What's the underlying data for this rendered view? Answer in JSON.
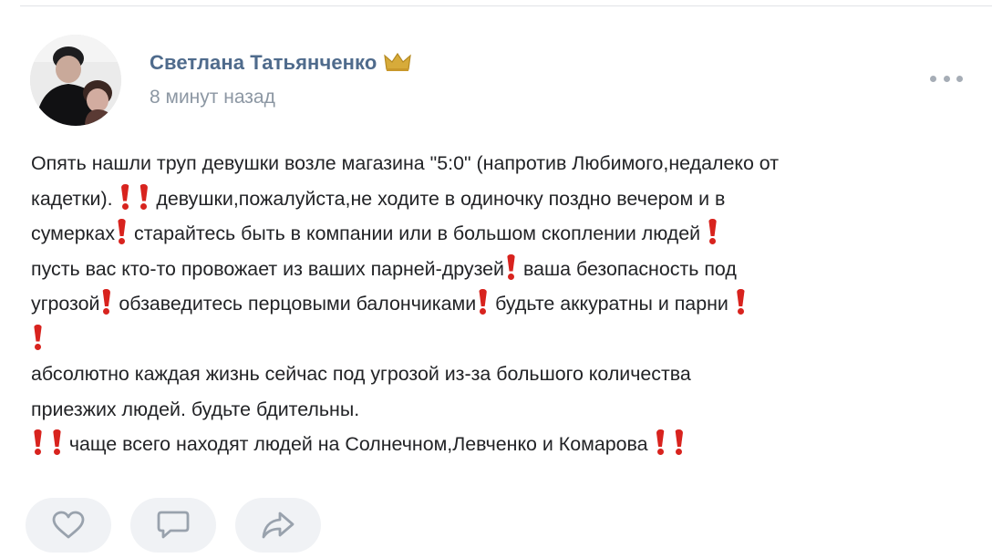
{
  "post": {
    "author_name": "Светлана Татьянченко",
    "author_badge_icon": "crown-icon",
    "time": "8 минут назад",
    "menu_icon": "more-dots-icon",
    "text_lines": [
      [
        {
          "t": "Опять нашли труп девушки возле магазина \"5:0\" (напротив Любимого,недалеко от"
        }
      ],
      [
        {
          "t": "кадетки). "
        },
        {
          "icon": "exclamation"
        },
        {
          "t": " "
        },
        {
          "icon": "exclamation"
        },
        {
          "t": " девушки,пожалуйста,не ходите в одиночку поздно вечером и в"
        }
      ],
      [
        {
          "t": "сумерках"
        },
        {
          "icon": "exclamation"
        },
        {
          "t": " старайтесь быть в компании или в большом скоплении людей "
        },
        {
          "icon": "exclamation"
        }
      ],
      [
        {
          "t": "пусть вас кто-то провожает из ваших парней-друзей"
        },
        {
          "icon": "exclamation"
        },
        {
          "t": " ваша безопасность под"
        }
      ],
      [
        {
          "t": "угрозой"
        },
        {
          "icon": "exclamation"
        },
        {
          "t": " обзаведитесь перцовыми балончиками"
        },
        {
          "icon": "exclamation"
        },
        {
          "t": " будьте аккуратны и парни "
        },
        {
          "icon": "exclamation"
        }
      ],
      [
        {
          "icon": "exclamation"
        }
      ],
      [
        {
          "t": "абсолютно каждая жизнь сейчас под угрозой из-за большого количества"
        }
      ],
      [
        {
          "t": "приезжих людей. будьте бдительны."
        }
      ],
      [
        {
          "icon": "exclamation"
        },
        {
          "t": " "
        },
        {
          "icon": "exclamation"
        },
        {
          "t": " чаще всего находят людей на Солнечном,Левченко и Комарова "
        },
        {
          "icon": "exclamation"
        },
        {
          "t": " "
        },
        {
          "icon": "exclamation"
        }
      ]
    ],
    "actions": [
      {
        "name": "like-button",
        "icon": "heart-icon"
      },
      {
        "name": "comment-button",
        "icon": "comment-icon"
      },
      {
        "name": "share-button",
        "icon": "share-icon"
      }
    ]
  },
  "colors": {
    "author_link": "#4f6b8c",
    "meta_text": "#8c97a3",
    "body_text": "#222326",
    "exclamation_red": "#d8231e",
    "action_bg": "#f0f2f5",
    "action_icon": "#99a2ad"
  }
}
